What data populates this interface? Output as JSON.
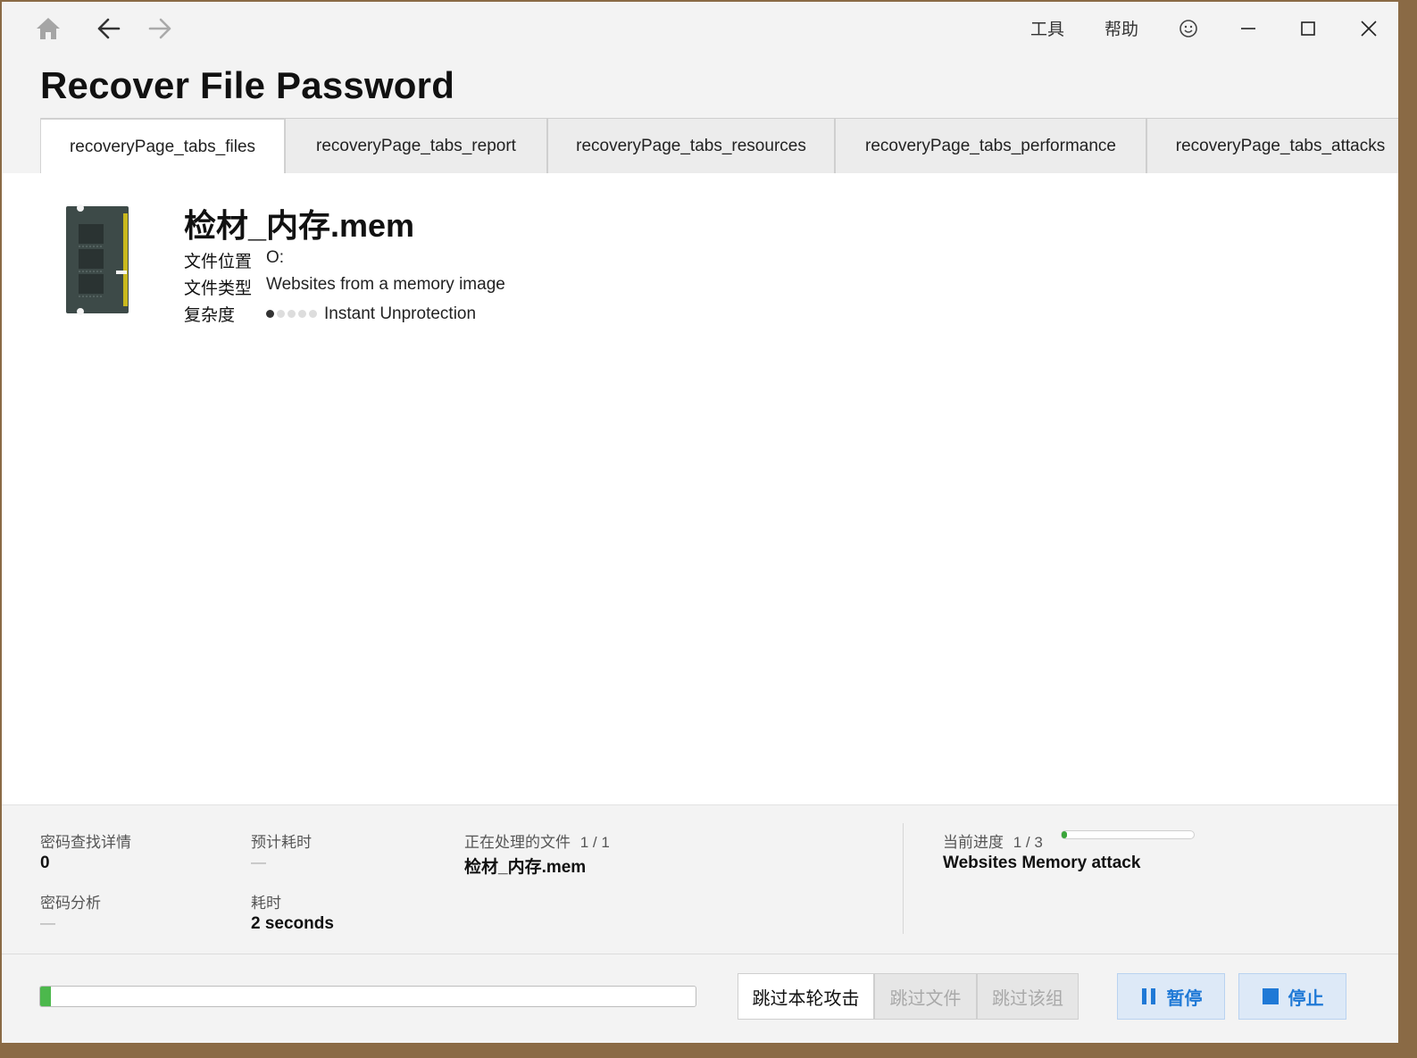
{
  "window": {
    "title": "Recover File Password",
    "menu": {
      "tools": "工具",
      "help": "帮助"
    },
    "icons": {
      "home": "home-icon",
      "back": "arrow-left-icon",
      "forward": "arrow-right-icon",
      "feedback": "smiley-icon",
      "minimize": "minimize-icon",
      "maximize": "maximize-icon",
      "close": "close-icon"
    }
  },
  "tabs": [
    {
      "label": "recoveryPage_tabs_files",
      "active": true
    },
    {
      "label": "recoveryPage_tabs_report",
      "active": false
    },
    {
      "label": "recoveryPage_tabs_resources",
      "active": false
    },
    {
      "label": "recoveryPage_tabs_performance",
      "active": false
    },
    {
      "label": "recoveryPage_tabs_attacks",
      "active": false
    }
  ],
  "file": {
    "icon": "memory-module-icon",
    "name": "检材_内存.mem",
    "location_label": "文件位置",
    "location_value": "O:",
    "type_label": "文件类型",
    "type_value": "Websites from a memory image",
    "complexity_label": "复杂度",
    "complexity_level": 1,
    "complexity_max": 5,
    "complexity_value": "Instant Unprotection"
  },
  "stats": {
    "found_label": "密码查找详情",
    "found_value": "0",
    "eta_label": "预计耗时",
    "eta_value": "—",
    "processing_label": "正在处理的文件",
    "processing_count": "1 / 1",
    "processing_value": "检材_内存.mem",
    "analysis_label": "密码分析",
    "analysis_value": "—",
    "elapsed_label": "耗时",
    "elapsed_value": "2 seconds",
    "progress_label": "当前进度",
    "progress_count": "1 / 3",
    "progress_fraction": 0.04,
    "attack_value": "Websites Memory attack"
  },
  "footer": {
    "overall_progress": 0.017,
    "skip_attack": "跳过本轮攻击",
    "skip_file": "跳过文件",
    "skip_group": "跳过该组",
    "pause": "暂停",
    "stop": "停止",
    "accent": "#1f79d6",
    "progress_color": "#4cb84c"
  }
}
